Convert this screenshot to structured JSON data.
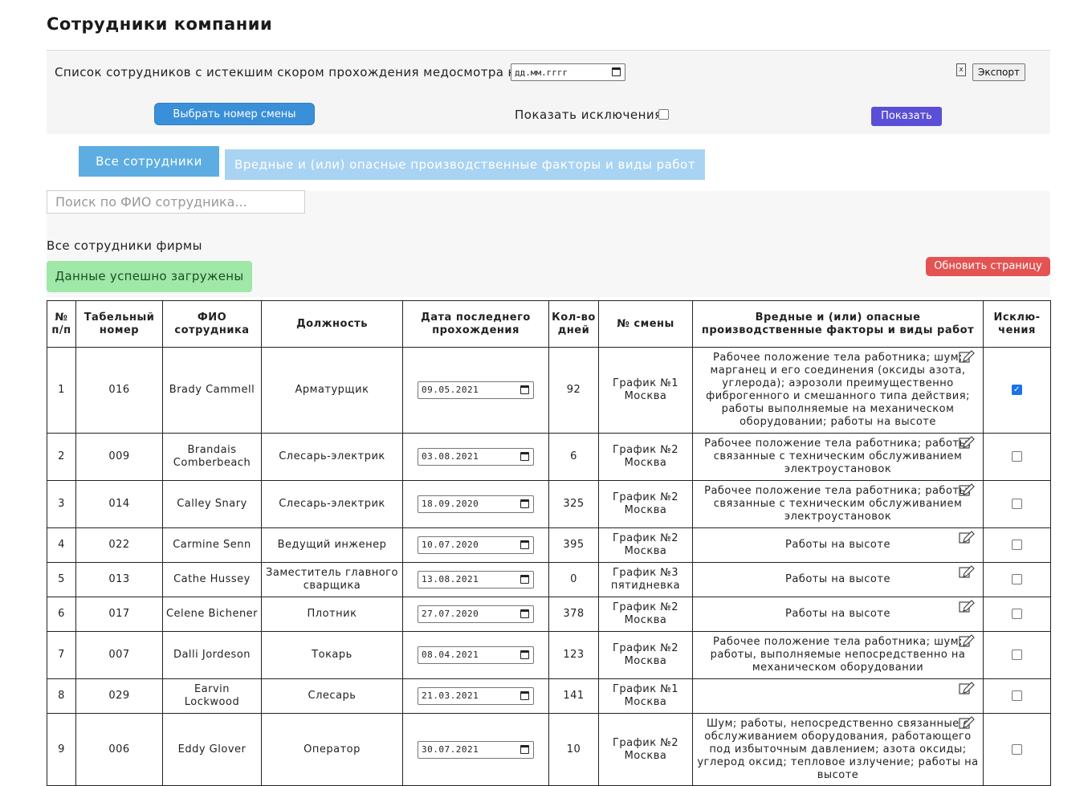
{
  "page": {
    "title": "Сотрудники компании"
  },
  "filter": {
    "label": "Список сотрудников с истекшим скором прохождения медосмотра на",
    "date_placeholder": "дд.мм.гггг",
    "export_label": "Экспорт",
    "shift_button": "Выбрать номер смены",
    "exceptions_label": "Показать исключения",
    "show_button": "Показать"
  },
  "tabs": {
    "all": "Все сотрудники",
    "harmful": "Вредные и (или) опасные производственные факторы и виды работ"
  },
  "search": {
    "placeholder": "Поиск по ФИО сотрудника..."
  },
  "section_label": "Все сотрудники фирмы",
  "alert": "Данные успешно загружены",
  "refresh_button": "Обновить страницу",
  "table": {
    "headers": {
      "num": "№ п/п",
      "tab": "Табельный номер",
      "fio": "ФИО сотрудника",
      "position": "Должность",
      "date": "Дата последнего прохождения",
      "days": "Кол-во дней",
      "shift": "№ смены",
      "harm": "Вредные и (или) опасные производственные факторы и виды работ",
      "exc": "Исклю-чения"
    },
    "rows": [
      {
        "num": "1",
        "tab": "016",
        "fio": "Brady Cammell",
        "position": "Арматурщик",
        "date": "09.05.2021",
        "days": "92",
        "shift": "График №1 Москва",
        "harm": "Рабочее положение тела работника; шум; марганец и его соединения (оксиды азота, углерода); аэрозоли преимущественно фиброгенного и смешанного типа действия; работы выполняемые на механическом оборудовании; работы на высоте",
        "exc": true
      },
      {
        "num": "2",
        "tab": "009",
        "fio": "Brandais Comberbeach",
        "position": "Слесарь-электрик",
        "date": "03.08.2021",
        "days": "6",
        "shift": "График №2 Москва",
        "harm": "Рабочее положение тела работника; работы, связанные с техническим обслуживанием электроустановок",
        "exc": false
      },
      {
        "num": "3",
        "tab": "014",
        "fio": "Calley Snary",
        "position": "Слесарь-электрик",
        "date": "18.09.2020",
        "days": "325",
        "shift": "График №2 Москва",
        "harm": "Рабочее положение тела работника; работы, связанные с техническим обслуживанием электроустановок",
        "exc": false
      },
      {
        "num": "4",
        "tab": "022",
        "fio": "Carmine Senn",
        "position": "Ведущий инженер",
        "date": "10.07.2020",
        "days": "395",
        "shift": "График №2 Москва",
        "harm": "Работы на высоте",
        "exc": false
      },
      {
        "num": "5",
        "tab": "013",
        "fio": "Cathe Hussey",
        "position": "Заместитель главного сварщика",
        "date": "13.08.2021",
        "days": "0",
        "shift": "График №3 пятидневка",
        "harm": "Работы на высоте",
        "exc": false
      },
      {
        "num": "6",
        "tab": "017",
        "fio": "Celene Bichener",
        "position": "Плотник",
        "date": "27.07.2020",
        "days": "378",
        "shift": "График №2 Москва",
        "harm": "Работы на высоте",
        "exc": false
      },
      {
        "num": "7",
        "tab": "007",
        "fio": "Dalli Jordeson",
        "position": "Токарь",
        "date": "08.04.2021",
        "days": "123",
        "shift": "График №2 Москва",
        "harm": "Рабочее положение тела работника; шум; работы, выполняемые непосредственно на механическом оборудовании",
        "exc": false
      },
      {
        "num": "8",
        "tab": "029",
        "fio": "Earvin Lockwood",
        "position": "Слесарь",
        "date": "21.03.2021",
        "days": "141",
        "shift": "График №1 Москва",
        "harm": "",
        "exc": false
      },
      {
        "num": "9",
        "tab": "006",
        "fio": "Eddy Glover",
        "position": "Оператор",
        "date": "30.07.2021",
        "days": "10",
        "shift": "График №2 Москва",
        "harm": "Шум; работы, непосредственно связанные с обслуживанием оборудования, работающего под избыточным давлением; азота оксиды; углерод оксид; тепловое излучение; работы на высоте",
        "exc": false
      }
    ]
  }
}
